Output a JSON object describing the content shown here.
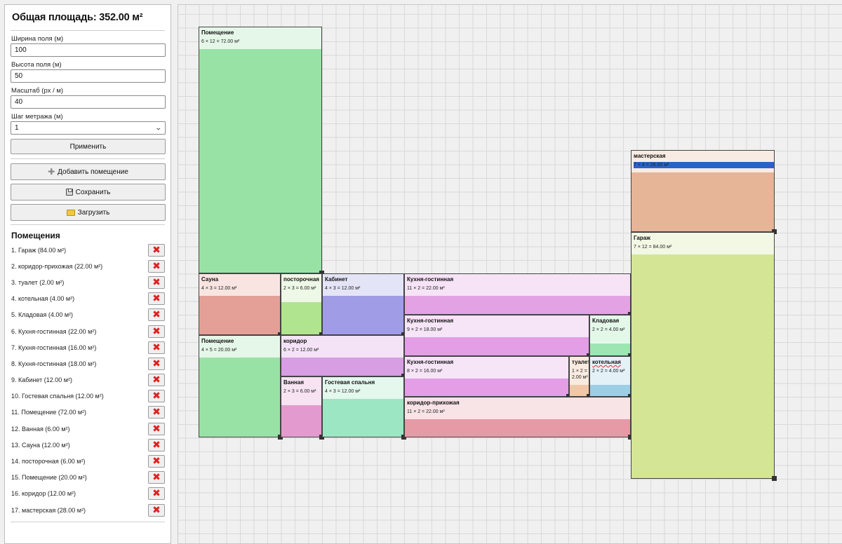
{
  "sidebar": {
    "total_area": "Общая площадь: 352.00 м²",
    "width_label": "Ширина поля (м)",
    "width_value": "100",
    "height_label": "Высота поля (м)",
    "height_value": "50",
    "scale_label": "Масштаб (px / м)",
    "scale_value": "40",
    "step_label": "Шаг метража (м)",
    "step_value": "1",
    "apply_label": "Применить",
    "add_room_label": "Добавить помещение",
    "save_label": "Сохранить",
    "load_label": "Загрузить",
    "rooms_title": "Помещения",
    "rooms": [
      "1. Гараж (84.00 м²)",
      "2. коридор-прихожая (22.00 м²)",
      "3. туалет (2.00 м²)",
      "4. котельная (4.00 м²)",
      "5. Кладовая (4.00 м²)",
      "6. Кухня-гостинная (22.00 м²)",
      "7. Кухня-гостинная (16.00 м²)",
      "8. Кухня-гостинная (18.00 м²)",
      "9. Кабинет (12.00 м²)",
      "10. Гостевая спальня (12.00 м²)",
      "11. Помещение (72.00 м²)",
      "12. Ванная (6.00 м²)",
      "13. Сауна (12.00 м²)",
      "14. посторочная (6.00 м²)",
      "15. Помещение (20.00 м²)",
      "16. коридор (12.00 м²)",
      "17. мастерская (28.00 м²)"
    ]
  },
  "plan": {
    "rooms": [
      {
        "name": "Помещение",
        "area": "6 × 12 = 72.00 м²",
        "color": "#98e2a6",
        "header_color": "#e5f7e8"
      },
      {
        "name": "Сауна",
        "area": "4 × 3 = 12.00 м²",
        "color": "#e4a096",
        "header_color": "#f8e4e1"
      },
      {
        "name": "посторочная",
        "area": "2 × 3 = 6.00 м²",
        "color": "#b1e48e",
        "header_color": "#eef8e6"
      },
      {
        "name": "Кабинет",
        "area": "4 × 3 = 12.00 м²",
        "color": "#a09de6",
        "header_color": "#e4e4f7"
      },
      {
        "name": "Кухня-гостинная",
        "area": "11 × 2 = 22.00 м²",
        "color": "#e3a2e3",
        "header_color": "#f6e3f6"
      },
      {
        "name": "Помещение",
        "area": "4 × 5 = 20.00 м²",
        "color": "#98e2a6",
        "header_color": "#e5f7e8"
      },
      {
        "name": "коридор",
        "area": "6 × 2 = 12.00 м²",
        "color": "#d89ee3",
        "header_color": "#f4e3f6"
      },
      {
        "name": "Ванная",
        "area": "2 × 3 = 6.00 м²",
        "color": "#e39bcf",
        "header_color": "#f7e3f1"
      },
      {
        "name": "Гостевая спальня",
        "area": "4 × 3 = 12.00 м²",
        "color": "#9ce6c4",
        "header_color": "#e4f8ee"
      },
      {
        "name": "Кухня-гостинная",
        "area": "9 × 2 = 18.00 м²",
        "color": "#e39ee6",
        "header_color": "#f6e4f7"
      },
      {
        "name": "Кладовая",
        "area": "2 × 2 = 4.00 м²",
        "color": "#9de6b4",
        "header_color": "#e4f8ea"
      },
      {
        "name": "Кухня-гостинная",
        "area": "8 × 2 = 16.00 м²",
        "color": "#e39ee6",
        "header_color": "#f6e4f7"
      },
      {
        "name": "туалет",
        "area": "1 × 2 = 2.00 м²",
        "color": "#f0c8a8",
        "header_color": "#faebe0"
      },
      {
        "name": "котельная",
        "area": "2 × 2 = 4.00 м²",
        "color": "#9ccfe6",
        "header_color": "#e4f2f8"
      },
      {
        "name": "коридор-прихожая",
        "area": "11 × 2 = 22.00 м²",
        "color": "#e69aa6",
        "header_color": "#f8e3e6"
      },
      {
        "name": "мастерская",
        "area": "7 × 4 = 28.00 м²",
        "color": "#e6b496",
        "header_color": "#f8ebe3"
      },
      {
        "name": "Гараж",
        "area": "7 × 12 = 84.00 м²",
        "color": "#d4e696",
        "header_color": "#f2f8e3"
      }
    ]
  }
}
